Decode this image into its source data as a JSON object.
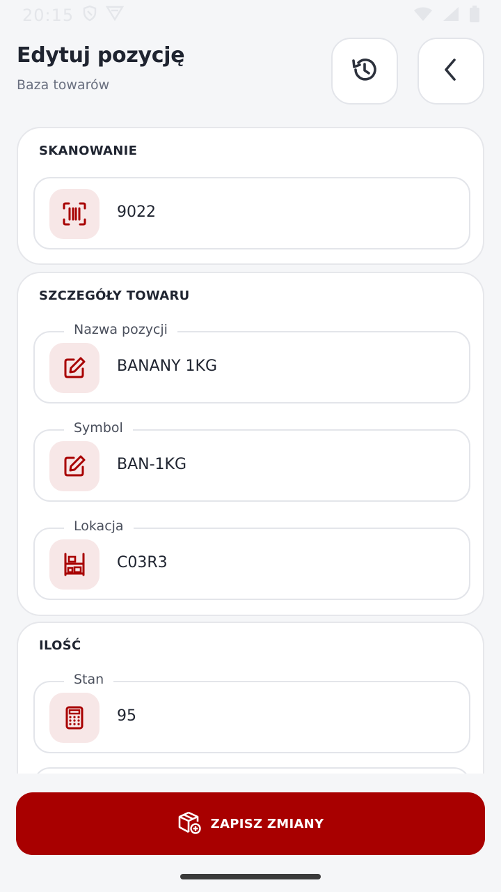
{
  "status_bar": {
    "time": "20:15"
  },
  "header": {
    "title": "Edytuj pozycję",
    "subtitle": "Baza towarów",
    "history_icon": "history-icon",
    "back_icon": "chevron-left-icon"
  },
  "sections": {
    "scan": {
      "title": "SKANOWANIE",
      "field": {
        "icon": "barcode-scan-icon",
        "value": "9022"
      }
    },
    "details": {
      "title": "SZCZEGÓŁY TOWARU",
      "fields": [
        {
          "label": "Nazwa pozycji",
          "icon": "edit-icon",
          "value": "BANANY 1KG"
        },
        {
          "label": "Symbol",
          "icon": "edit-icon",
          "value": "BAN-1KG"
        },
        {
          "label": "Lokacja",
          "icon": "shelf-icon",
          "value": "C03R3"
        }
      ]
    },
    "quantity": {
      "title": "ILOŚĆ",
      "fields": [
        {
          "label": "Stan",
          "icon": "calculator-icon",
          "value": "95"
        }
      ]
    }
  },
  "save_button": {
    "label": "ZAPISZ ZMIANY",
    "icon": "package-add-icon"
  },
  "colors": {
    "accent": "#a80000",
    "icon_bg": "#f7e7e7",
    "background": "#f5f6f8"
  }
}
